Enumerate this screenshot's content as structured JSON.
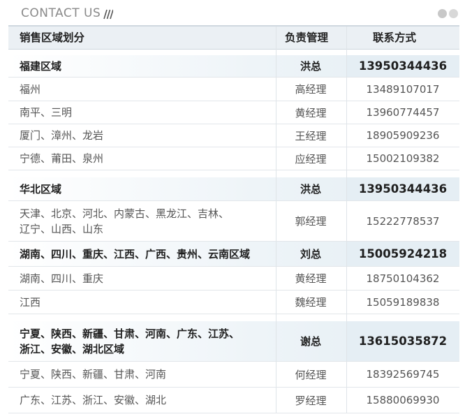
{
  "header": {
    "title": "CONTACT US"
  },
  "table": {
    "columns": [
      "销售区域划分",
      "负责管理",
      "联系方式"
    ],
    "rows": [
      {
        "region": "福建区域",
        "manager": "洪总",
        "phone": "13950344436"
      },
      {
        "region": "福州",
        "manager": "高经理",
        "phone": "13489107017"
      },
      {
        "region": "南平、三明",
        "manager": "黄经理",
        "phone": "13960774457"
      },
      {
        "region": "厦门、漳州、龙岩",
        "manager": "王经理",
        "phone": "18905909236"
      },
      {
        "region": "宁德、莆田、泉州",
        "manager": "应经理",
        "phone": "15002109382"
      },
      {
        "region": "华北区域",
        "manager": "洪总",
        "phone": "13950344436"
      },
      {
        "region": "天津、北京、河北、内蒙古、黑龙江、吉林、\n辽宁、山西、山东",
        "manager": "郭经理",
        "phone": "15222778537"
      },
      {
        "region": "湖南、四川、重庆、江西、广西、贵州、云南区域",
        "manager": "刘总",
        "phone": "15005924218"
      },
      {
        "region": "湖南、四川、重庆",
        "manager": "黄经理",
        "phone": "18750104362"
      },
      {
        "region": "江西",
        "manager": "魏经理",
        "phone": "15059189838"
      },
      {
        "region": "宁夏、陕西、新疆、甘肃、河南、广东、江苏、\n浙江、安徽、湖北区域",
        "manager": "谢总",
        "phone": "13615035872"
      },
      {
        "region": "宁夏、陕西、新疆、甘肃、河南",
        "manager": "何经理",
        "phone": "18392569745"
      },
      {
        "region": "广东、江苏、浙江、安徽、湖北",
        "manager": "罗经理",
        "phone": "15880069930"
      }
    ]
  }
}
